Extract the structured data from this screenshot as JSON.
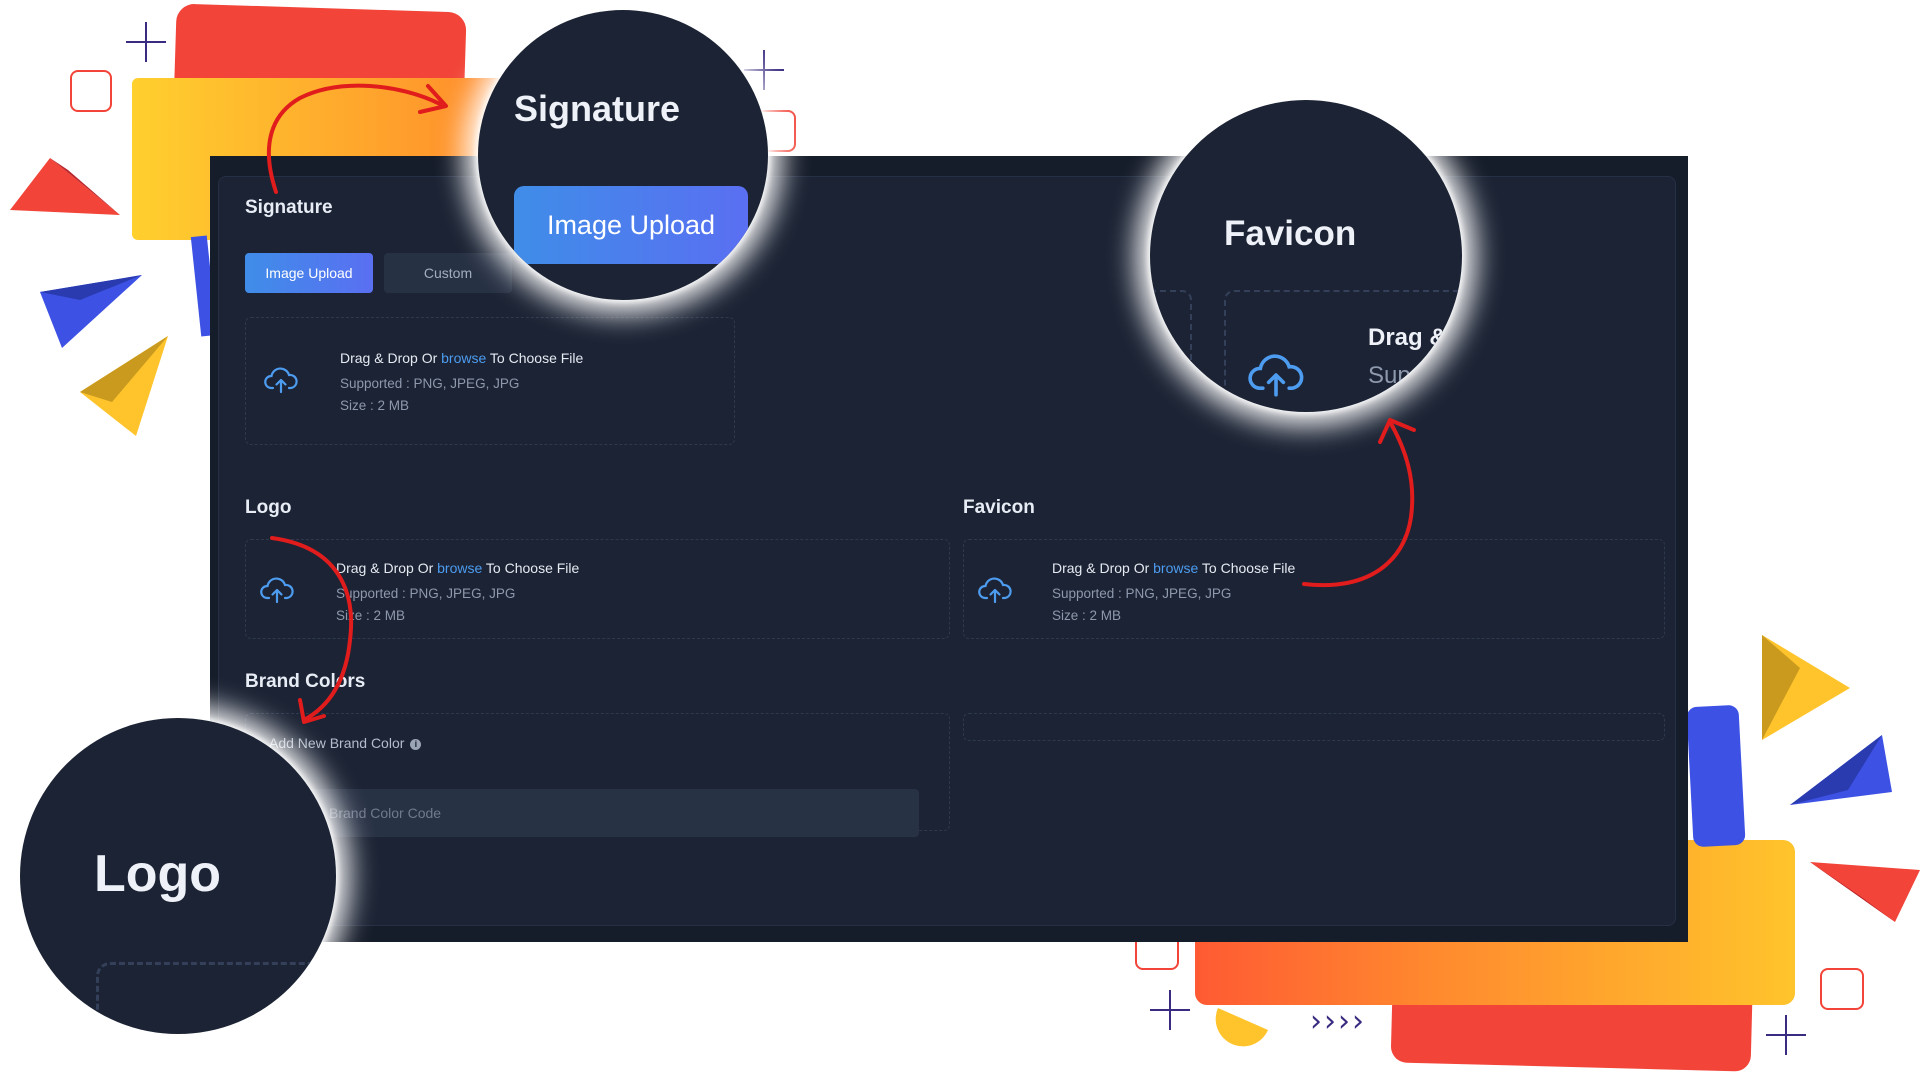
{
  "signature": {
    "title": "Signature",
    "tab_image_upload": "Image Upload",
    "tab_custom": "Custom"
  },
  "dropzone": {
    "prefix": "Drag & Drop Or ",
    "link": "browse",
    "suffix": " To Choose File",
    "supported": "Supported : PNG, JPEG, JPG",
    "size": "Size : 2 MB"
  },
  "logo": {
    "title": "Logo"
  },
  "favicon": {
    "title": "Favicon"
  },
  "brand_colors": {
    "title": "Brand Colors",
    "add_label": "Add New Brand Color",
    "input_placeholder": "Brand Color Code",
    "add_label_visible": "dd New Brand Color",
    "input_placeholder_visible": "Brand Color Code"
  },
  "zoom_bubbles": {
    "signature_title": "Signature",
    "signature_button": "Image Upload",
    "favicon_title": "Favicon",
    "favicon_drag_partial": "Drag &",
    "favicon_sup_partial": "Sup",
    "logo_title": "Logo"
  },
  "decoration": {
    "chevrons": "››››"
  },
  "colors": {
    "panel_bg": "#151c2a",
    "card_bg": "#1b2334",
    "accent_blue": "#4d9cf0",
    "arrow_red": "#e01c1c",
    "deco_red": "#f24438",
    "deco_yellow": "#ffc42c",
    "deco_blue": "#3d52e5"
  },
  "icons": [
    "cloud-upload-icon",
    "info-icon"
  ]
}
